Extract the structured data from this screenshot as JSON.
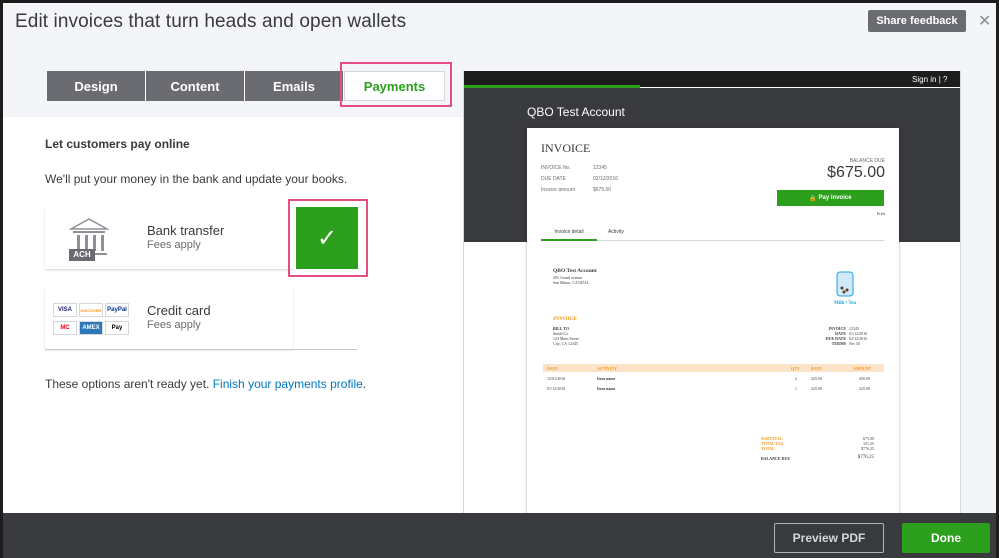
{
  "dialog": {
    "title": "Edit invoices that turn heads and open wallets",
    "share_label": "Share feedback",
    "close_label": "✕"
  },
  "tabs": [
    {
      "label": "Design"
    },
    {
      "label": "Content"
    },
    {
      "label": "Emails"
    },
    {
      "label": "Payments"
    }
  ],
  "payments": {
    "heading": "Let customers pay online",
    "description": "We'll put your money in the bank and update your books.",
    "bank": {
      "label": "Bank transfer",
      "sub": "Fees apply",
      "badge": "ACH"
    },
    "card": {
      "label": "Credit card",
      "sub": "Fees apply",
      "logos": [
        "VISA",
        "DISCOVER",
        "PayPal",
        "MC",
        "AMEX",
        "Pay"
      ]
    },
    "not_ready": "These options aren't ready yet. ",
    "finish_link": "Finish your payments profile",
    "finish_period": "."
  },
  "preview": {
    "signin": "Sign in",
    "account": "QBO Test Account",
    "invoice_heading": "INVOICE",
    "meta": [
      {
        "k": "INVOICE No.",
        "v": "12345"
      },
      {
        "k": "DUE DATE",
        "v": "02/12/2016"
      },
      {
        "k": "Invoice amount",
        "v": "$675.00"
      }
    ],
    "balance_label": "BALANCE DUE",
    "balance": "$675.00",
    "pay_button": "Pay invoice",
    "print": "Print",
    "tab_detail": "Invoice detail",
    "tab_activity": "Activity",
    "doc": {
      "company": "QBO Test Account",
      "address": [
        "291 Grand avenue",
        "San Mateo, CA 94514"
      ],
      "logo_text": "Milk • Tea",
      "title": "INVOICE",
      "billto": [
        "BILL TO",
        "Smith Co.",
        "123 Main Street",
        "City, CA 12345"
      ],
      "rmeta_k": [
        "INVOICE",
        "DATE",
        "DUE DATE",
        "TERMS"
      ],
      "rmeta_v": [
        "12345",
        "01/12/2016",
        "02/12/2016",
        "Net 30"
      ],
      "cols": [
        "DATE",
        "ACTIVITY",
        "QTY",
        "RATE",
        "AMOUNT"
      ],
      "rows": [
        {
          "date": "12/01/2016",
          "item": "Item name",
          "qty": "2",
          "rate": "225.00",
          "amt": "450.00"
        },
        {
          "date": "01/12/2016",
          "item": "Item name",
          "qty": "1",
          "rate": "225.00",
          "amt": "225.00"
        }
      ],
      "totals_k": [
        "SUBTOTAL",
        "TOTAL TAX",
        "TOTAL"
      ],
      "totals_v": [
        "675.00",
        "101.25",
        "$776.25"
      ],
      "baldue_k": "BALANCE DUE",
      "baldue_v": "$776.25"
    }
  },
  "footer": {
    "preview_pdf": "Preview PDF",
    "done": "Done"
  },
  "colors": {
    "green": "#2ca01c",
    "highlight": "#e54e80",
    "dark": "#393a3d"
  }
}
